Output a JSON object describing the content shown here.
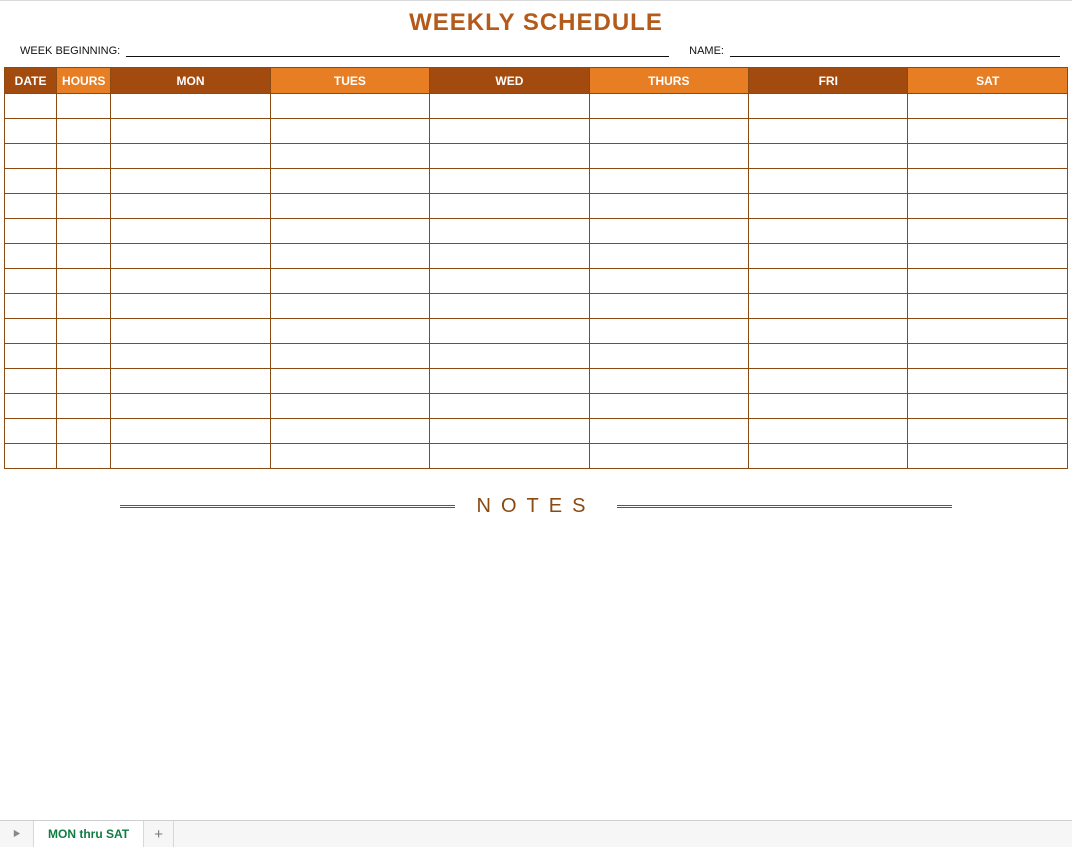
{
  "title": "WEEKLY SCHEDULE",
  "meta": {
    "week_label": "WEEK BEGINNING:",
    "week_value": "",
    "name_label": "NAME:",
    "name_value": ""
  },
  "headers": {
    "date": "DATE",
    "hours": "HOURS",
    "mon": "MON",
    "tues": "TUES",
    "wed": "WED",
    "thurs": "THURS",
    "fri": "FRI",
    "sat": "SAT"
  },
  "rows": [
    {
      "date": "",
      "hours": "",
      "mon": "",
      "tues": "",
      "wed": "",
      "thurs": "",
      "fri": "",
      "sat": ""
    },
    {
      "date": "",
      "hours": "",
      "mon": "",
      "tues": "",
      "wed": "",
      "thurs": "",
      "fri": "",
      "sat": ""
    },
    {
      "date": "",
      "hours": "",
      "mon": "",
      "tues": "",
      "wed": "",
      "thurs": "",
      "fri": "",
      "sat": ""
    },
    {
      "date": "",
      "hours": "",
      "mon": "",
      "tues": "",
      "wed": "",
      "thurs": "",
      "fri": "",
      "sat": ""
    },
    {
      "date": "",
      "hours": "",
      "mon": "",
      "tues": "",
      "wed": "",
      "thurs": "",
      "fri": "",
      "sat": ""
    },
    {
      "date": "",
      "hours": "",
      "mon": "",
      "tues": "",
      "wed": "",
      "thurs": "",
      "fri": "",
      "sat": ""
    },
    {
      "date": "",
      "hours": "",
      "mon": "",
      "tues": "",
      "wed": "",
      "thurs": "",
      "fri": "",
      "sat": ""
    },
    {
      "date": "",
      "hours": "",
      "mon": "",
      "tues": "",
      "wed": "",
      "thurs": "",
      "fri": "",
      "sat": ""
    },
    {
      "date": "",
      "hours": "",
      "mon": "",
      "tues": "",
      "wed": "",
      "thurs": "",
      "fri": "",
      "sat": ""
    },
    {
      "date": "",
      "hours": "",
      "mon": "",
      "tues": "",
      "wed": "",
      "thurs": "",
      "fri": "",
      "sat": ""
    },
    {
      "date": "",
      "hours": "",
      "mon": "",
      "tues": "",
      "wed": "",
      "thurs": "",
      "fri": "",
      "sat": ""
    },
    {
      "date": "",
      "hours": "",
      "mon": "",
      "tues": "",
      "wed": "",
      "thurs": "",
      "fri": "",
      "sat": ""
    },
    {
      "date": "",
      "hours": "",
      "mon": "",
      "tues": "",
      "wed": "",
      "thurs": "",
      "fri": "",
      "sat": ""
    },
    {
      "date": "",
      "hours": "",
      "mon": "",
      "tues": "",
      "wed": "",
      "thurs": "",
      "fri": "",
      "sat": ""
    },
    {
      "date": "",
      "hours": "",
      "mon": "",
      "tues": "",
      "wed": "",
      "thurs": "",
      "fri": "",
      "sat": ""
    }
  ],
  "notes_title": "NOTES",
  "tabbar": {
    "sheet_name": "MON thru SAT",
    "add_label": "+"
  },
  "colors": {
    "brown": "#a34a0e",
    "orange": "#e77e24",
    "border": "#8a4a12",
    "tab_green": "#107c41"
  }
}
